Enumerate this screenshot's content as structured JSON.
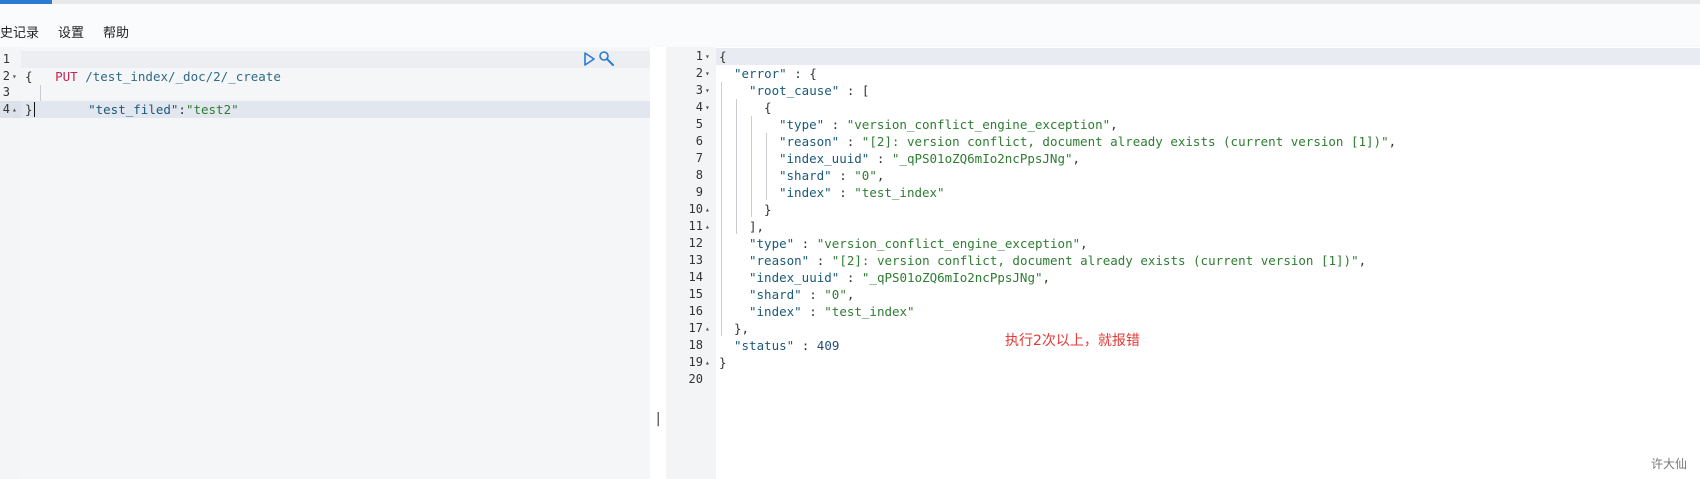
{
  "menu": {
    "items": [
      "史记录",
      "设置",
      "帮助"
    ]
  },
  "request_editor": {
    "line_numbers": [
      "1",
      "2",
      "3",
      "4"
    ],
    "method": "PUT",
    "path": "/test_index/_doc/2/_create",
    "body_open": "{",
    "body_key": "\"test_filed\"",
    "body_colon": ":",
    "body_value": "\"test2\"",
    "body_close": "}",
    "play_icon": "play-icon",
    "wrench_icon": "wrench-icon"
  },
  "response_viewer": {
    "line_numbers": [
      "1",
      "2",
      "3",
      "4",
      "5",
      "6",
      "7",
      "8",
      "9",
      "10",
      "11",
      "12",
      "13",
      "14",
      "15",
      "16",
      "17",
      "18",
      "19",
      "20"
    ],
    "lines": [
      [
        [
          "{",
          "punc"
        ]
      ],
      [
        [
          "\"error\"",
          "key"
        ],
        [
          " : {",
          "punc"
        ]
      ],
      [
        [
          "\"root_cause\"",
          "key"
        ],
        [
          " : [",
          "punc"
        ]
      ],
      [
        [
          "{",
          "punc"
        ]
      ],
      [
        [
          "\"type\"",
          "key"
        ],
        [
          " : ",
          "punc"
        ],
        [
          "\"version_conflict_engine_exception\"",
          "str"
        ],
        [
          ",",
          "punc"
        ]
      ],
      [
        [
          "\"reason\"",
          "key"
        ],
        [
          " : ",
          "punc"
        ],
        [
          "\"[2]: version conflict, document already exists (current version [1])\"",
          "str"
        ],
        [
          ",",
          "punc"
        ]
      ],
      [
        [
          "\"index_uuid\"",
          "key"
        ],
        [
          " : ",
          "punc"
        ],
        [
          "\"_qPS01oZQ6mIo2ncPpsJNg\"",
          "str"
        ],
        [
          ",",
          "punc"
        ]
      ],
      [
        [
          "\"shard\"",
          "key"
        ],
        [
          " : ",
          "punc"
        ],
        [
          "\"0\"",
          "str"
        ],
        [
          ",",
          "punc"
        ]
      ],
      [
        [
          "\"index\"",
          "key"
        ],
        [
          " : ",
          "punc"
        ],
        [
          "\"test_index\"",
          "str"
        ]
      ],
      [
        [
          "}",
          "punc"
        ]
      ],
      [
        [
          "],",
          "punc"
        ]
      ],
      [
        [
          "\"type\"",
          "key"
        ],
        [
          " : ",
          "punc"
        ],
        [
          "\"version_conflict_engine_exception\"",
          "str"
        ],
        [
          ",",
          "punc"
        ]
      ],
      [
        [
          "\"reason\"",
          "key"
        ],
        [
          " : ",
          "punc"
        ],
        [
          "\"[2]: version conflict, document already exists (current version [1])\"",
          "str"
        ],
        [
          ",",
          "punc"
        ]
      ],
      [
        [
          "\"index_uuid\"",
          "key"
        ],
        [
          " : ",
          "punc"
        ],
        [
          "\"_qPS01oZQ6mIo2ncPpsJNg\"",
          "str"
        ],
        [
          ",",
          "punc"
        ]
      ],
      [
        [
          "\"shard\"",
          "key"
        ],
        [
          " : ",
          "punc"
        ],
        [
          "\"0\"",
          "str"
        ],
        [
          ",",
          "punc"
        ]
      ],
      [
        [
          "\"index\"",
          "key"
        ],
        [
          " : ",
          "punc"
        ],
        [
          "\"test_index\"",
          "str"
        ]
      ],
      [
        [
          "},",
          "punc"
        ]
      ],
      [
        [
          "\"status\"",
          "key"
        ],
        [
          " : ",
          "punc"
        ],
        [
          "409",
          "num"
        ]
      ],
      [
        [
          "}",
          "punc"
        ]
      ],
      []
    ]
  },
  "annotation": "执行2次以上，就报错",
  "watermark": "许大仙",
  "splitter_glyph": "||",
  "colors": {
    "accent": "#2a7bd3",
    "method": "#c7254e",
    "string": "#2e7d32",
    "annotation": "#e53935"
  }
}
